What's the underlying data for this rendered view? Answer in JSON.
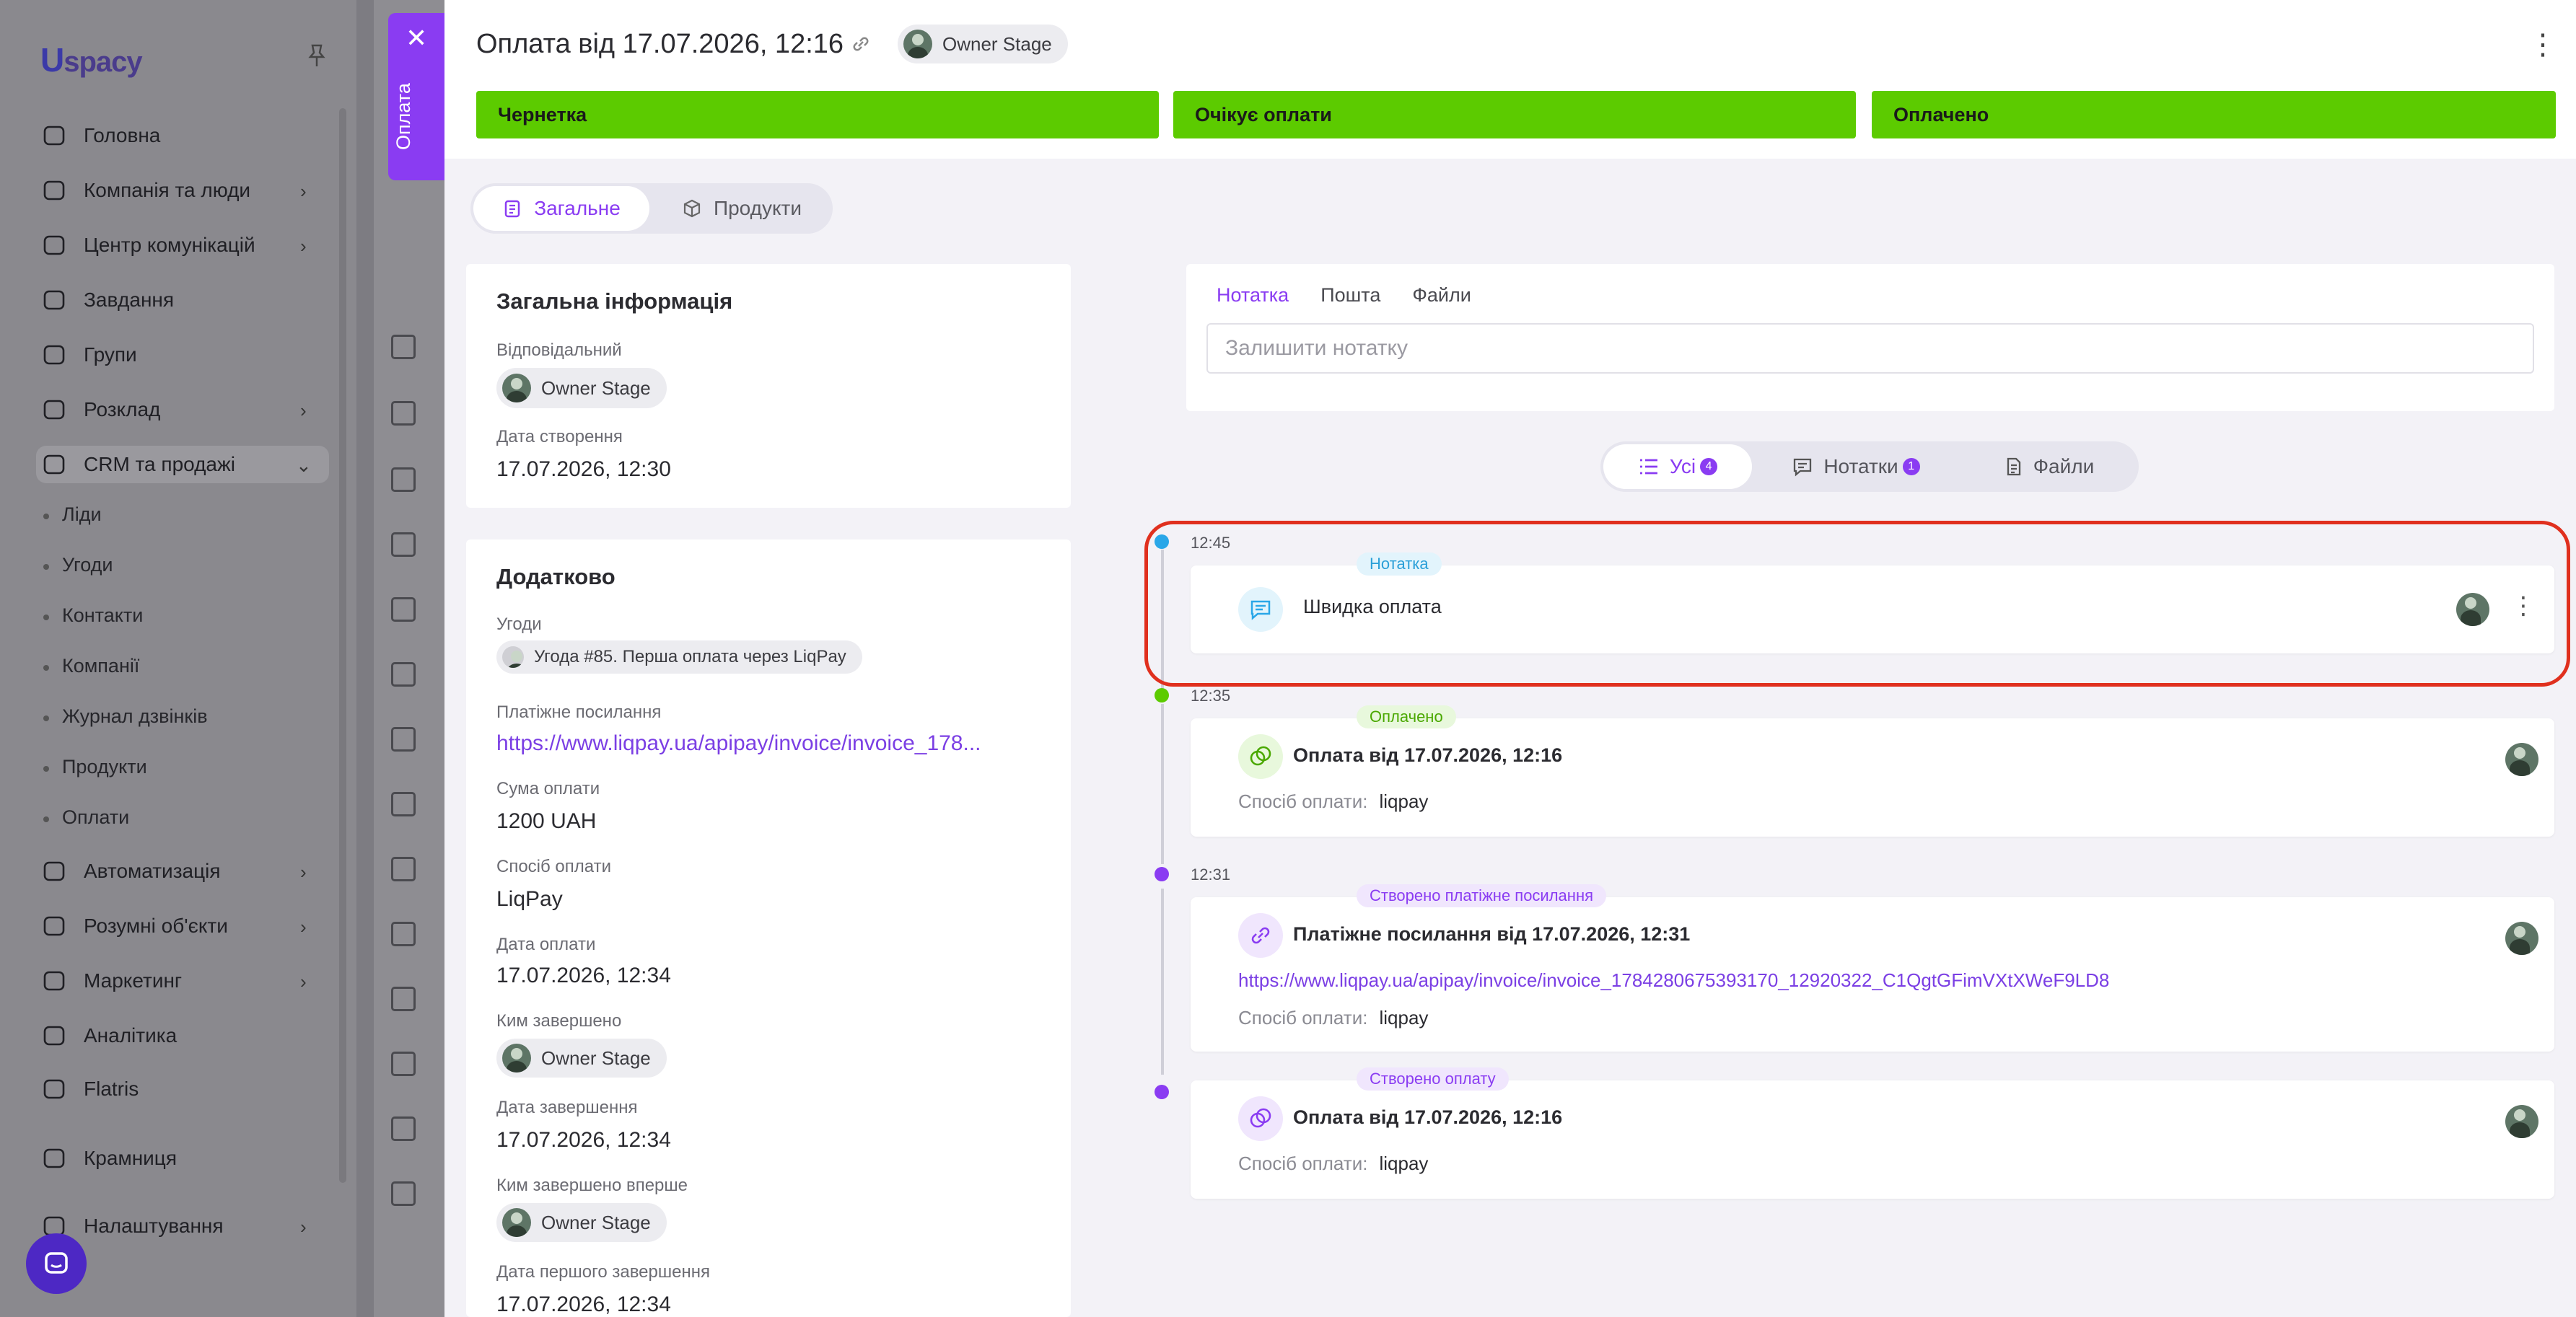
{
  "sidebar": {
    "logo": "spacy",
    "items": [
      {
        "label": "Головна",
        "icon": "home-icon",
        "chev": false
      },
      {
        "label": "Компанія та люди",
        "icon": "company-icon",
        "chev": true
      },
      {
        "label": "Центр комунікацій",
        "icon": "communications-icon",
        "chev": true
      },
      {
        "label": "Завдання",
        "icon": "tasks-icon",
        "chev": false
      },
      {
        "label": "Групи",
        "icon": "groups-icon",
        "chev": false
      },
      {
        "label": "Розклад",
        "icon": "calendar-icon",
        "chev": true
      },
      {
        "label": "CRM та продажі",
        "icon": "crm-icon",
        "chev": true
      }
    ],
    "sub_items": [
      "Ліди",
      "Угоди",
      "Контакти",
      "Компанії",
      "Журнал дзвінків",
      "Продукти",
      "Оплати"
    ],
    "items2": [
      {
        "label": "Автоматизація",
        "icon": "automation-icon",
        "chev": true
      },
      {
        "label": "Розумні об'єкти",
        "icon": "smart-objects-icon",
        "chev": true
      },
      {
        "label": "Маркетинг",
        "icon": "marketing-icon",
        "chev": true
      },
      {
        "label": "Аналітика",
        "icon": "analytics-icon",
        "chev": false
      },
      {
        "label": "Flatris",
        "icon": "flatris-icon",
        "chev": false
      },
      {
        "label": "Крамниця",
        "icon": "store-icon",
        "chev": false
      },
      {
        "label": "Налаштування",
        "icon": "settings-icon",
        "chev": true
      }
    ]
  },
  "sidetab": {
    "label": "Оплата"
  },
  "header": {
    "title": "Оплата від 17.07.2026, 12:16",
    "owner": "Owner Stage",
    "stages": [
      "Чернетка",
      "Очікує оплати",
      "Оплачено"
    ],
    "stage_color": "#5ccb00"
  },
  "tabs": {
    "general": "Загальне",
    "products": "Продукти"
  },
  "general_info": {
    "title": "Загальна інформація",
    "responsible_label": "Відповідальний",
    "responsible": "Owner Stage",
    "created_label": "Дата створення",
    "created": "17.07.2026, 12:30"
  },
  "extra": {
    "title": "Додатково",
    "deals_label": "Угоди",
    "deal": "Угода #85. Перша оплата через LiqPay",
    "link_label": "Платіжне посилання",
    "link": "https://www.liqpay.ua/apipay/invoice/invoice_178...",
    "sum_label": "Сума оплати",
    "sum": "1200 UAH",
    "method_label": "Спосіб оплати",
    "method": "LiqPay",
    "paid_label": "Дата оплати",
    "paid": "17.07.2026, 12:34",
    "completed_by_label": "Ким завершено",
    "completed_by": "Owner Stage",
    "completed_label": "Дата завершення",
    "completed": "17.07.2026, 12:34",
    "first_by_label": "Ким завершено вперше",
    "first_by": "Owner Stage",
    "first_label": "Дата першого завершення",
    "first": "17.07.2026, 12:34"
  },
  "composer": {
    "tabs": [
      "Нотатка",
      "Пошта",
      "Файли"
    ],
    "placeholder": "Залишити нотатку"
  },
  "filters": [
    {
      "label": "Усі",
      "count": "4"
    },
    {
      "label": "Нотатки",
      "count": "1"
    },
    {
      "label": "Файли",
      "count": ""
    }
  ],
  "timeline": [
    {
      "time": "12:45",
      "tag": "Нотатка",
      "title": "Швидка оплата"
    },
    {
      "time": "12:35",
      "tag": "Оплачено",
      "title": "Оплата від 17.07.2026, 12:16",
      "sub_label": "Спосіб оплати:",
      "sub_value": "liqpay"
    },
    {
      "time": "12:31",
      "tag": "Створено платіжне посилання",
      "title": "Платіжне посилання від 17.07.2026, 12:31",
      "link": "https://www.liqpay.ua/apipay/invoice/invoice_1784280675393170_12920322_C1QgtGFimVXtXWeF9LD8",
      "sub_label": "Спосіб оплати:",
      "sub_value": "liqpay"
    },
    {
      "time": "",
      "tag": "Створено оплату",
      "title": "Оплата від 17.07.2026, 12:16",
      "sub_label": "Спосіб оплати:",
      "sub_value": "liqpay"
    }
  ],
  "colors": {
    "accent": "#8a3cf2",
    "note": "#2aa7e8",
    "paid": "#5ccb00",
    "highlight": "#e0301e"
  }
}
